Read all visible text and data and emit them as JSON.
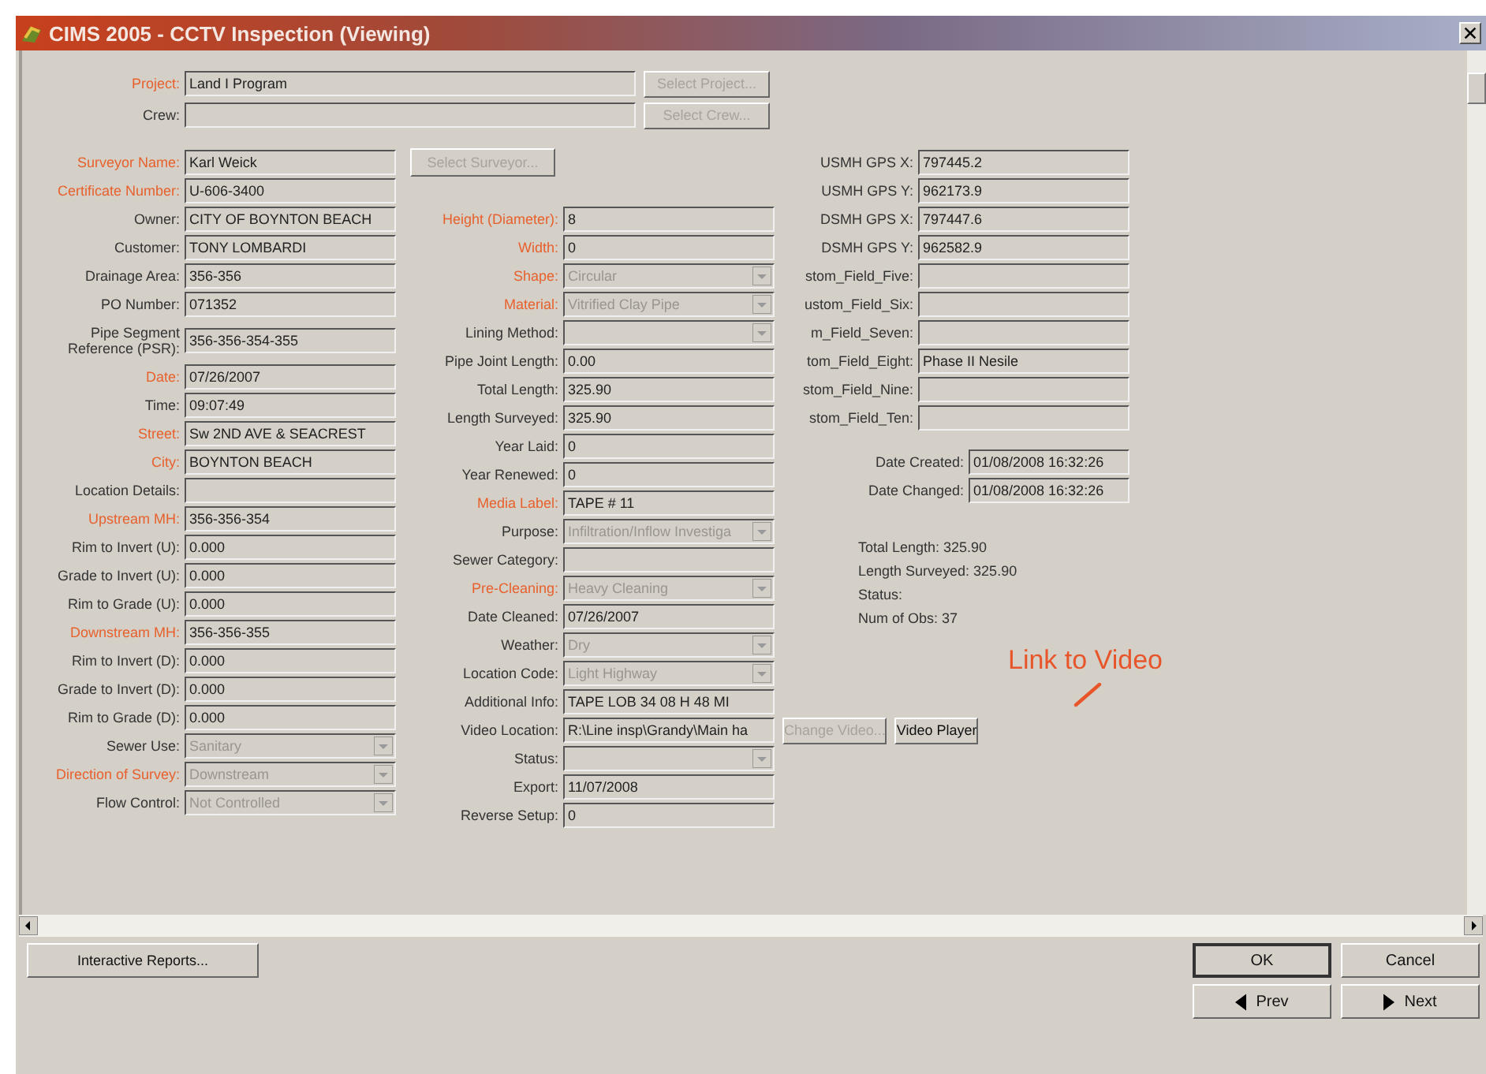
{
  "window": {
    "title": "CIMS 2005 - CCTV Inspection (Viewing)"
  },
  "top_fields": [
    {
      "label": "Project:",
      "required": true,
      "value": "Land I Program",
      "button": {
        "label": "Select Project...",
        "disabled": true
      }
    },
    {
      "label": "Crew:",
      "required": false,
      "button": {
        "label": "Select Crew...",
        "disabled": true
      }
    }
  ],
  "left_fields": [
    {
      "kind": "text",
      "label": "Surveyor Name:",
      "required": true,
      "value": "Karl Weick"
    },
    {
      "kind": "text",
      "label": "Certificate Number:",
      "required": true,
      "value": "U-606-3400"
    },
    {
      "kind": "text",
      "label": "Owner:",
      "required": false,
      "value": "CITY OF BOYNTON BEACH"
    },
    {
      "kind": "text",
      "label": "Customer:",
      "required": false,
      "value": "TONY LOMBARDI"
    },
    {
      "kind": "text",
      "label": "Drainage Area:",
      "required": false,
      "value": "356-356"
    },
    {
      "kind": "text",
      "label": "PO Number:",
      "required": false,
      "value": "071352"
    },
    {
      "kind": "text",
      "label": "Pipe Segment Reference (PSR):",
      "required": false,
      "value": "356-356-354-355"
    },
    {
      "kind": "text",
      "label": "Date:",
      "required": true,
      "value": "07/26/2007"
    },
    {
      "kind": "text",
      "label": "Time:",
      "required": false,
      "value": "09:07:49"
    },
    {
      "kind": "text",
      "label": "Street:",
      "required": true,
      "value": "Sw 2ND AVE & SEACREST"
    },
    {
      "kind": "text",
      "label": "City:",
      "required": true,
      "value": "BOYNTON BEACH"
    },
    {
      "kind": "text",
      "label": "Location Details:",
      "required": false
    },
    {
      "kind": "text",
      "label": "Upstream MH:",
      "required": true,
      "value": "356-356-354"
    },
    {
      "kind": "text",
      "label": "Rim to Invert (U):",
      "required": false,
      "value": "0.000"
    },
    {
      "kind": "text",
      "label": "Grade to Invert (U):",
      "required": false,
      "value": "0.000"
    },
    {
      "kind": "text",
      "label": "Rim to Grade (U):",
      "required": false,
      "value": "0.000"
    },
    {
      "kind": "text",
      "label": "Downstream MH:",
      "required": true,
      "value": "356-356-355"
    },
    {
      "kind": "text",
      "label": "Rim to Invert (D):",
      "required": false,
      "value": "0.000"
    },
    {
      "kind": "text",
      "label": "Grade to Invert (D):",
      "required": false,
      "value": "0.000"
    },
    {
      "kind": "text",
      "label": "Rim to Grade (D):",
      "required": false,
      "value": "0.000"
    },
    {
      "kind": "dropdown",
      "label": "Sewer Use:",
      "required": false,
      "value": "Sanitary",
      "disabled": true
    },
    {
      "kind": "dropdown",
      "label": "Direction of Survey:",
      "required": true,
      "value": "Downstream",
      "disabled": true
    },
    {
      "kind": "dropdown",
      "label": "Flow Control:",
      "required": false,
      "value": "Not Controlled",
      "disabled": true
    }
  ],
  "surveyor_button": {
    "label": "Select Surveyor...",
    "disabled": true
  },
  "middle_fields": [
    {
      "kind": "text",
      "label": "Height (Diameter):",
      "required": true,
      "value": "8"
    },
    {
      "kind": "text",
      "label": "Width:",
      "required": true,
      "value": "0"
    },
    {
      "kind": "dropdown",
      "label": "Shape:",
      "required": true,
      "value": "Circular",
      "disabled": true
    },
    {
      "kind": "dropdown",
      "label": "Material:",
      "required": true,
      "value": "Vitrified Clay Pipe",
      "disabled": true
    },
    {
      "kind": "dropdown",
      "label": "Lining Method:",
      "required": false,
      "disabled": true
    },
    {
      "kind": "text",
      "label": "Pipe Joint Length:",
      "required": false,
      "value": "0.00"
    },
    {
      "kind": "text",
      "label": "Total Length:",
      "required": false,
      "value": "325.90"
    },
    {
      "kind": "text",
      "label": "Length Surveyed:",
      "required": false,
      "value": "325.90"
    },
    {
      "kind": "text",
      "label": "Year Laid:",
      "required": false,
      "value": "0"
    },
    {
      "kind": "text",
      "label": "Year Renewed:",
      "required": false,
      "value": "0"
    },
    {
      "kind": "text",
      "label": "Media Label:",
      "required": true,
      "value": "TAPE # 11"
    },
    {
      "kind": "dropdown",
      "label": "Purpose:",
      "required": false,
      "value": "Infiltration/Inflow Investiga",
      "disabled": true
    },
    {
      "kind": "text",
      "label": "Sewer Category:",
      "required": false
    },
    {
      "kind": "dropdown",
      "label": "Pre-Cleaning:",
      "required": true,
      "value": "Heavy Cleaning",
      "disabled": true
    },
    {
      "kind": "text",
      "label": "Date Cleaned:",
      "required": false,
      "value": "07/26/2007"
    },
    {
      "kind": "dropdown",
      "label": "Weather:",
      "required": false,
      "value": "Dry",
      "disabled": true
    },
    {
      "kind": "dropdown",
      "label": "Location Code:",
      "required": false,
      "value": "Light Highway",
      "disabled": true
    },
    {
      "kind": "text",
      "label": "Additional Info:",
      "required": false,
      "value": "TAPE LOB 34 08 H 48 MI"
    },
    {
      "kind": "text",
      "label": "Video Location:",
      "required": false,
      "value": "R:\\Line insp\\Grandy\\Main ha",
      "buttons": [
        {
          "label": "Change Video...",
          "disabled": true
        },
        {
          "label": "Video Player",
          "disabled": false
        }
      ]
    },
    {
      "kind": "dropdown",
      "label": "Status:",
      "required": false,
      "disabled": true
    },
    {
      "kind": "text",
      "label": "Export:",
      "required": false,
      "value": "11/07/2008"
    },
    {
      "kind": "text",
      "label": "Reverse Setup:",
      "required": false,
      "value": "0"
    }
  ],
  "right_fields": [
    {
      "label": "USMH GPS X:",
      "value": "797445.2"
    },
    {
      "label": "USMH GPS Y:",
      "value": "962173.9"
    },
    {
      "label": "DSMH GPS X:",
      "value": "797447.6"
    },
    {
      "label": "DSMH GPS Y:",
      "value": "962582.9"
    },
    {
      "label": "stom_Field_Five:"
    },
    {
      "label": "ustom_Field_Six:"
    },
    {
      "label": "m_Field_Seven:"
    },
    {
      "label": "tom_Field_Eight:",
      "value": "Phase II Nesile"
    },
    {
      "label": "stom_Field_Nine:"
    },
    {
      "label": "stom_Field_Ten:"
    }
  ],
  "dates": [
    {
      "label": "Date Created:",
      "value": "01/08/2008 16:32:26"
    },
    {
      "label": "Date Changed:",
      "value": "01/08/2008 16:32:26"
    }
  ],
  "summary": [
    "Total Length: 325.90",
    "Length Surveyed: 325.90",
    "Status:",
    "Num of Obs: 37"
  ],
  "annotation": "Link to Video",
  "bottom_buttons": [
    {
      "label": "Interactive Reports..."
    }
  ],
  "dialog_buttons": [
    {
      "label": "OK",
      "kind": "plain",
      "default": true
    },
    {
      "label": "Cancel",
      "kind": "plain",
      "default": false
    },
    {
      "label": "Prev",
      "kind": "prev",
      "default": false
    },
    {
      "label": "Next",
      "kind": "next",
      "default": false
    }
  ]
}
